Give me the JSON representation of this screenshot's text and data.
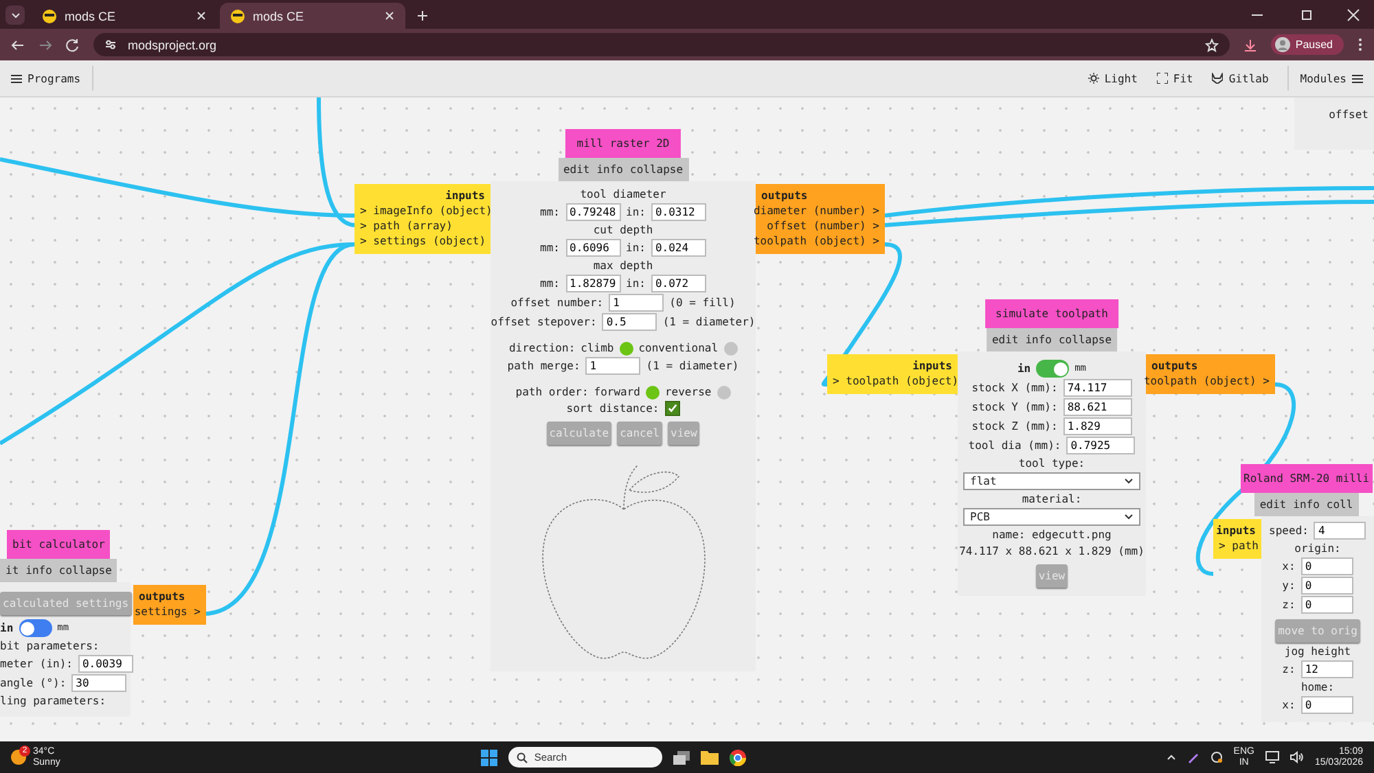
{
  "browser": {
    "tabs": [
      {
        "title": "mods CE",
        "selected": false
      },
      {
        "title": "mods CE",
        "selected": true
      }
    ],
    "url": "modsproject.org",
    "profile_status": "Paused"
  },
  "toolbar": {
    "programs": "Programs",
    "items": [
      "Light",
      "Fit",
      "Gitlab"
    ],
    "modules": "Modules"
  },
  "nodes": [
    {
      "rows": [
        {
          "kind": "label",
          "text": "offset"
        }
      ]
    },
    {
      "title": "mill raster 2D",
      "menu": [
        "edit",
        "info",
        "collapse"
      ],
      "inputs": {
        "heading": "inputs",
        "ports": [
          "> imageInfo (object)",
          "> path (array)",
          "> settings (object)"
        ]
      },
      "outputs": {
        "heading": "outputs",
        "ports": [
          "diameter (number) >",
          "offset (number) >",
          "toolpath (object) >"
        ]
      },
      "rows": [
        {
          "kind": "label",
          "text": "tool diameter"
        },
        {
          "kind": "dual",
          "label1": "mm:",
          "value1": "0.79248",
          "label2": "in:",
          "value2": "0.0312"
        },
        {
          "kind": "label",
          "text": "cut depth"
        },
        {
          "kind": "dual",
          "label1": "mm:",
          "value1": "0.6096",
          "label2": "in:",
          "value2": "0.024"
        },
        {
          "kind": "label",
          "text": "max depth"
        },
        {
          "kind": "dual",
          "label1": "mm:",
          "value1": "1.82879",
          "label2": "in:",
          "value2": "0.072"
        },
        {
          "kind": "field",
          "label": "offset number:",
          "value": "1",
          "note": "(0 = fill)"
        },
        {
          "kind": "field",
          "label": "offset stepover:",
          "value": "0.5",
          "note": "(1 = diameter)"
        },
        {
          "kind": "radio",
          "label": "direction:",
          "options": [
            {
              "label": "climb",
              "selected": true
            },
            {
              "label": "conventional",
              "selected": false
            }
          ]
        },
        {
          "kind": "field",
          "label": "path merge:",
          "value": "1",
          "note": "(1 = diameter)"
        },
        {
          "kind": "radio",
          "label": "path order:",
          "options": [
            {
              "label": "forward",
              "selected": true
            },
            {
              "label": "reverse",
              "selected": false
            }
          ]
        },
        {
          "kind": "check",
          "label": "sort distance:",
          "checked": true
        },
        {
          "kind": "buttons",
          "buttons": [
            "calculate",
            "cancel",
            "view"
          ]
        },
        {
          "kind": "preview"
        }
      ]
    },
    {
      "title": "simulate toolpath",
      "menu": [
        "edit",
        "info",
        "collapse"
      ],
      "inputs": {
        "heading": "inputs",
        "ports": [
          "> toolpath (object)"
        ]
      },
      "outputs": {
        "heading": "outputs",
        "ports": [
          "toolpath (object) >"
        ]
      },
      "rows": [
        {
          "kind": "toggle",
          "left": "in",
          "right": "mm",
          "on": true
        },
        {
          "kind": "field",
          "label": "stock X (mm):",
          "value": "74.117"
        },
        {
          "kind": "field",
          "label": "stock Y (mm):",
          "value": "88.621"
        },
        {
          "kind": "field",
          "label": "stock Z (mm):",
          "value": "1.829"
        },
        {
          "kind": "field",
          "label": "tool dia (mm):",
          "value": "0.7925"
        },
        {
          "kind": "label",
          "text": "tool type:"
        },
        {
          "kind": "select",
          "value": "flat"
        },
        {
          "kind": "label",
          "text": "material:"
        },
        {
          "kind": "select",
          "value": "PCB"
        },
        {
          "kind": "label",
          "text": "name: edgecutt.png"
        },
        {
          "kind": "label",
          "text": "74.117 x 88.621 x 1.829 (mm)"
        },
        {
          "kind": "buttons",
          "buttons": [
            "view"
          ]
        }
      ]
    },
    {
      "title": "bit calculator",
      "menu": [
        "it",
        "info",
        "collapse"
      ],
      "outputs": {
        "heading": "outputs",
        "ports": [
          "settings >"
        ]
      },
      "rows": [
        {
          "kind": "buttons",
          "buttons": [
            "calculated settings"
          ]
        },
        {
          "kind": "toggle",
          "left": "in",
          "right": "mm",
          "on": false
        },
        {
          "kind": "label",
          "text": "bit parameters:"
        },
        {
          "kind": "field",
          "label": "meter (in):",
          "value": "0.0039"
        },
        {
          "kind": "field",
          "label": "angle (°):",
          "value": "30"
        },
        {
          "kind": "label",
          "text": "ling parameters:"
        }
      ]
    },
    {
      "title": "Roland SRM-20 milli",
      "menu": [
        "edit",
        "info",
        "coll"
      ],
      "inputs": {
        "heading": "inputs",
        "ports": [
          "> path"
        ]
      },
      "rows": [
        {
          "kind": "field",
          "label": "speed:",
          "value": "4"
        },
        {
          "kind": "label",
          "text": "origin:"
        },
        {
          "kind": "field",
          "label": "x:",
          "value": "0"
        },
        {
          "kind": "field",
          "label": "y:",
          "value": "0"
        },
        {
          "kind": "field",
          "label": "z:",
          "value": "0"
        },
        {
          "kind": "buttons",
          "buttons": [
            "move to orig"
          ]
        },
        {
          "kind": "label",
          "text": "jog height"
        },
        {
          "kind": "field",
          "label": "z:",
          "value": "12"
        },
        {
          "kind": "label",
          "text": "home:"
        },
        {
          "kind": "field",
          "label": "x:",
          "value": "0"
        }
      ]
    }
  ],
  "taskbar": {
    "weather_badge": "2",
    "temperature": "34°C",
    "weather": "Sunny",
    "search": "Search",
    "language": "ENG",
    "region": "IN",
    "time": "15:09",
    "date": "15/03/2026"
  }
}
